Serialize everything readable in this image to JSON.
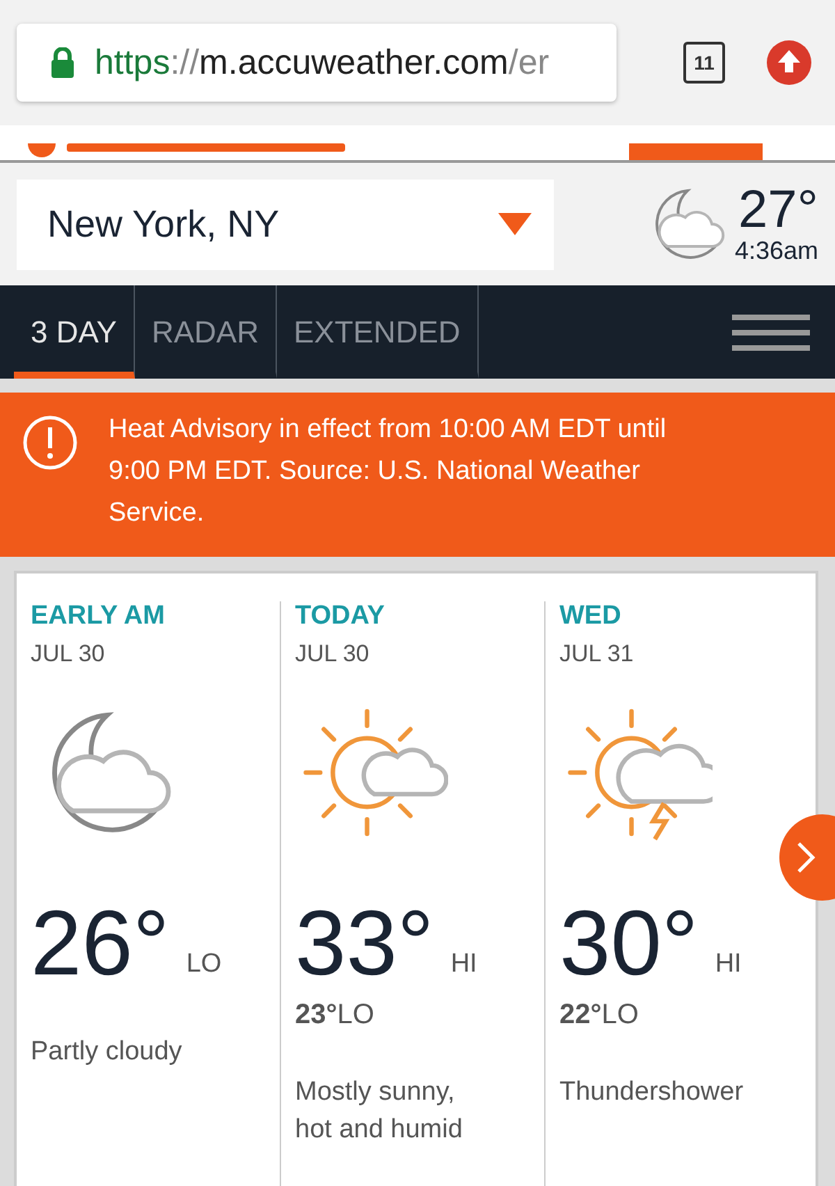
{
  "browser": {
    "url_scheme": "https",
    "url_separator": "://",
    "url_host": "m.accuweather.com",
    "url_rest": "/er",
    "tab_count": "11"
  },
  "location": {
    "value": "New York, NY"
  },
  "current": {
    "kind": "moon-cloud",
    "temperature": "27°",
    "time": "4:36am"
  },
  "nav": {
    "tabs": [
      {
        "label": "3 DAY",
        "selected": true
      },
      {
        "label": "RADAR",
        "selected": false
      },
      {
        "label": "EXTENDED",
        "selected": false
      }
    ]
  },
  "alert": {
    "text": "Heat Advisory in effect from 10:00 AM EDT until 9:00 PM EDT. Source: U.S. National Weather Service."
  },
  "days": [
    {
      "label": "EARLY AM",
      "date": "JUL 30",
      "kind": "moon-cloud",
      "temperature": "26°",
      "temp_kind": "LO",
      "description": "Partly cloudy"
    },
    {
      "label": "TODAY",
      "date": "JUL 30",
      "kind": "sun-cloud",
      "temperature": "33°",
      "temp_kind": "HI",
      "low": "**23°**LO",
      "description": "Mostly sunny, hot and humid"
    },
    {
      "label": "WED",
      "date": "JUL 31",
      "kind": "sun-storm",
      "temperature": "30°",
      "temp_kind": "HI",
      "low": "**22°**LO",
      "description": "Thundershower"
    }
  ]
}
